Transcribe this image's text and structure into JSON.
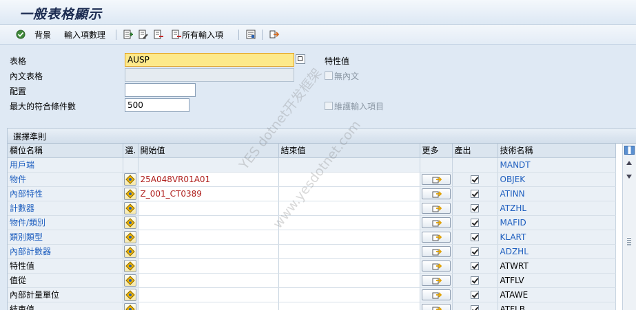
{
  "window": {
    "title": "一般表格顯示"
  },
  "toolbar": {
    "background_label": "背景",
    "entries_count_label": "輸入項數理",
    "all_entries_label": "所有輸入項"
  },
  "form": {
    "table_label": "表格",
    "table_value": "AUSP",
    "text_table_label": "內文表格",
    "layout_label": "配置",
    "layout_value": "",
    "max_hits_label": "最大的符合條件數",
    "max_hits_value": "500",
    "char_value_label": "特性值",
    "no_text_label": "無內文",
    "maintain_entries_label": "維護輸入項目"
  },
  "selection": {
    "title": "選擇準則",
    "columns": {
      "field_name": "欄位名稱",
      "sel": "選.",
      "from": "開始值",
      "to": "結束值",
      "more": "更多",
      "output": "產出",
      "tech_name": "技術名稱"
    },
    "rows": [
      {
        "name": "用戶端",
        "from": "",
        "tech": "MANDT",
        "key": true,
        "has_sel": false,
        "has_more": false,
        "has_out": false
      },
      {
        "name": "物件",
        "from": "25A048VR01A01",
        "tech": "OBJEK",
        "key": true,
        "has_sel": true,
        "has_more": true,
        "has_out": true
      },
      {
        "name": "內部特性",
        "from": "Z_001_CT0389",
        "tech": "ATINN",
        "key": true,
        "has_sel": true,
        "has_more": true,
        "has_out": true
      },
      {
        "name": "計數器",
        "from": "",
        "tech": "ATZHL",
        "key": true,
        "has_sel": true,
        "has_more": true,
        "has_out": true
      },
      {
        "name": "物件/類別",
        "from": "",
        "tech": "MAFID",
        "key": true,
        "has_sel": true,
        "has_more": true,
        "has_out": true
      },
      {
        "name": "類別類型",
        "from": "",
        "tech": "KLART",
        "key": true,
        "has_sel": true,
        "has_more": true,
        "has_out": true
      },
      {
        "name": "內部計數器",
        "from": "",
        "tech": "ADZHL",
        "key": true,
        "has_sel": true,
        "has_more": true,
        "has_out": true
      },
      {
        "name": "特性值",
        "from": "",
        "tech": "ATWRT",
        "key": false,
        "has_sel": true,
        "has_more": true,
        "has_out": true
      },
      {
        "name": "值從",
        "from": "",
        "tech": "ATFLV",
        "key": false,
        "has_sel": true,
        "has_more": true,
        "has_out": true
      },
      {
        "name": "內部計量單位",
        "from": "",
        "tech": "ATAWE",
        "key": false,
        "has_sel": true,
        "has_more": true,
        "has_out": true
      },
      {
        "name": "結束值",
        "from": "",
        "tech": "ATFLB",
        "key": false,
        "has_sel": true,
        "has_more": true,
        "has_out": true
      }
    ]
  },
  "watermark": {
    "line1": "YES dotnet开发框架",
    "line2": "www.yesdotnet.com"
  },
  "icons": {
    "execute": "execute-icon",
    "create": "create-entry-icon",
    "change": "change-entry-icon",
    "delete": "delete-entry-icon",
    "all": "all-entries-icon",
    "print": "print-list-icon",
    "exit": "exit-icon",
    "select": "select-options-icon",
    "more": "multiple-selection-icon",
    "layout": "layout-settings-icon"
  },
  "colors": {
    "key_field": "#1f5fbf",
    "value_text": "#b0201e",
    "focus_field": "#fde98a"
  }
}
